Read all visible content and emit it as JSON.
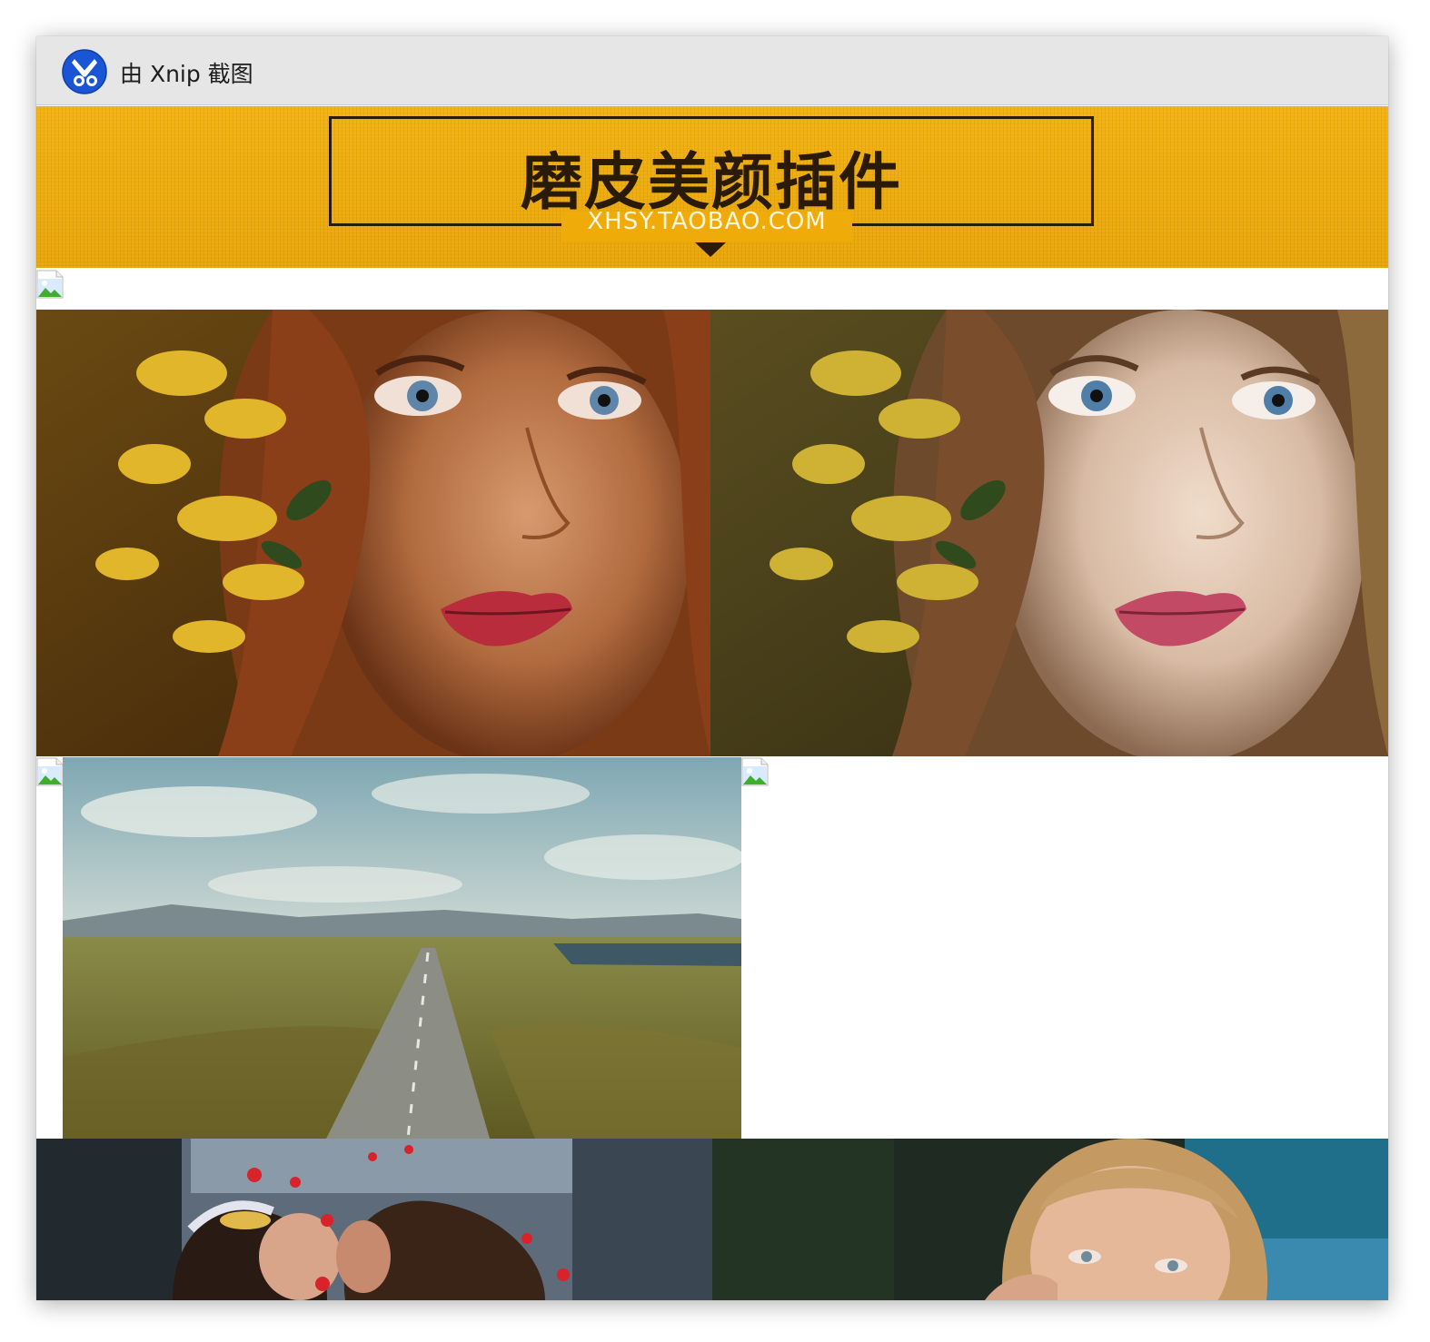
{
  "window": {
    "title": "由 Xnip 截图",
    "app_icon": "xnip-scissors-icon"
  },
  "banner": {
    "title": "磨皮美颜插件",
    "url": "XHSY.TAOBAO.COM",
    "color": "#efab0a"
  },
  "images": [
    {
      "name": "broken-image-icon",
      "state": "failed-to-load"
    },
    {
      "name": "portrait-before",
      "state": "loaded"
    },
    {
      "name": "portrait-after",
      "state": "loaded"
    },
    {
      "name": "broken-image-icon",
      "state": "failed-to-load"
    },
    {
      "name": "road-landscape",
      "state": "loaded"
    },
    {
      "name": "broken-image-icon",
      "state": "failed-to-load"
    },
    {
      "name": "wedding-kiss",
      "state": "loaded"
    },
    {
      "name": "girl-portrait",
      "state": "loaded"
    }
  ]
}
